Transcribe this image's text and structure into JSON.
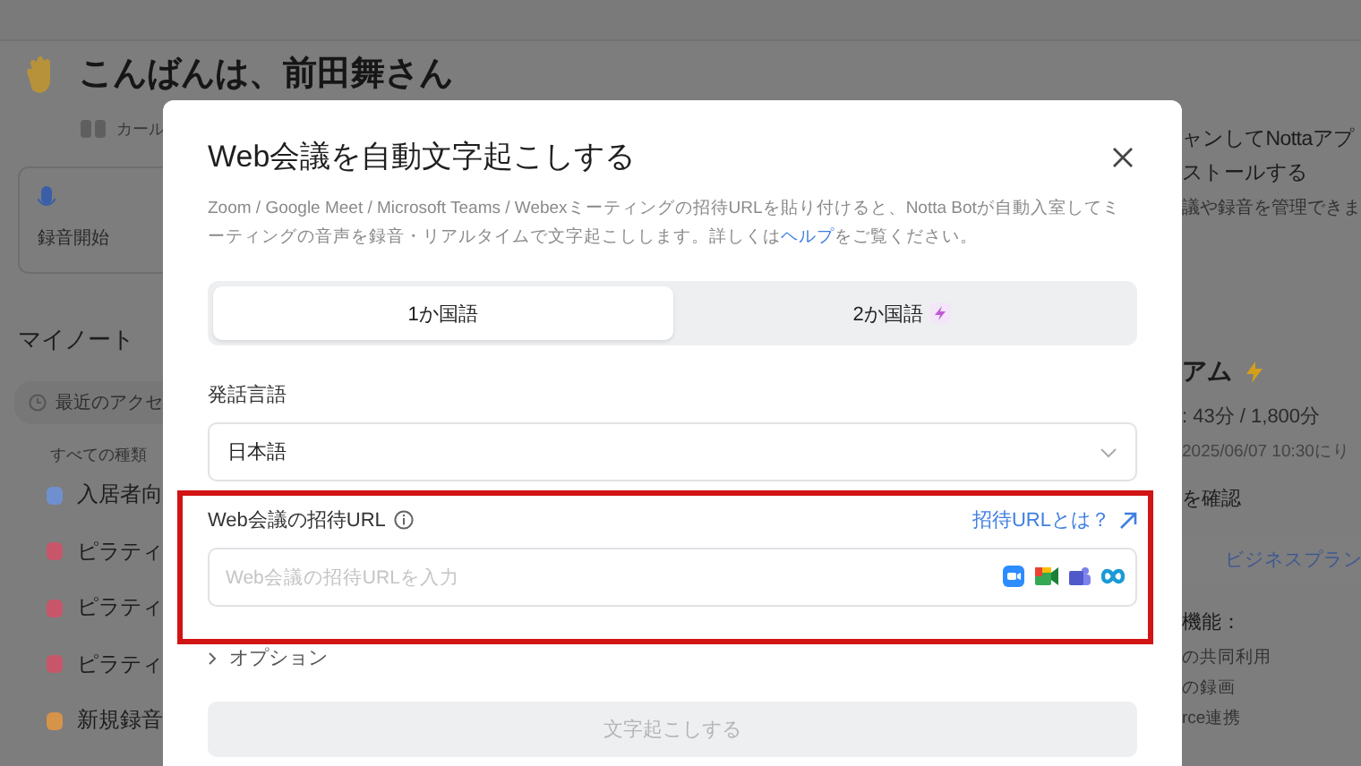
{
  "background": {
    "greeting": "こんばんは、前田舞さん",
    "quote": "カール",
    "record_card": "録音開始",
    "my_notes_heading": "マイノート",
    "recent_filter": "最近のアクセ",
    "type_filter": "すべての種類",
    "notes": [
      {
        "kind": "audio",
        "title": "入居者向"
      },
      {
        "kind": "meeting",
        "title": "ピラティ"
      },
      {
        "kind": "meeting",
        "title": "ピラティ"
      },
      {
        "kind": "meeting",
        "title": "ピラティ"
      },
      {
        "kind": "video",
        "title": "新規録音"
      }
    ],
    "right_panel": {
      "lines": [
        "ャンしてNottaアプ",
        "ストールする"
      ],
      "note": "議や録音を管理できま",
      "plan_title": "アム",
      "usage": ": 43分 / 1,800分",
      "reset": "2025/06/07 10:30にり",
      "check": "を確認",
      "upgrade_button": "ビジネスプラン",
      "features_heading": "機能：",
      "features": [
        "の共同利用",
        "の録画",
        "rce連携"
      ]
    }
  },
  "dialog": {
    "title": "Web会議を自動文字起こしする",
    "description_before": "Zoom / Google Meet / Microsoft Teams / Webexミーティングの招待URLを貼り付けると、Notta Botが自動入室してミーティングの音声を録音・リアルタイムで文字起こしします。詳しくは",
    "help_link": "ヘルプ",
    "description_after": "をご覧ください。",
    "tabs": [
      {
        "label": "1か国語",
        "selected": true,
        "premium": false
      },
      {
        "label": "2か国語",
        "selected": false,
        "premium": true
      }
    ],
    "language_label": "発話言語",
    "language_value": "日本語",
    "url_label": "Web会議の招待URL",
    "url_help_link": "招待URLとは？",
    "url_placeholder": "Web会議の招待URLを入力",
    "options_label": "オプション",
    "submit_button": "文字起こしする",
    "submit_disabled": true
  }
}
